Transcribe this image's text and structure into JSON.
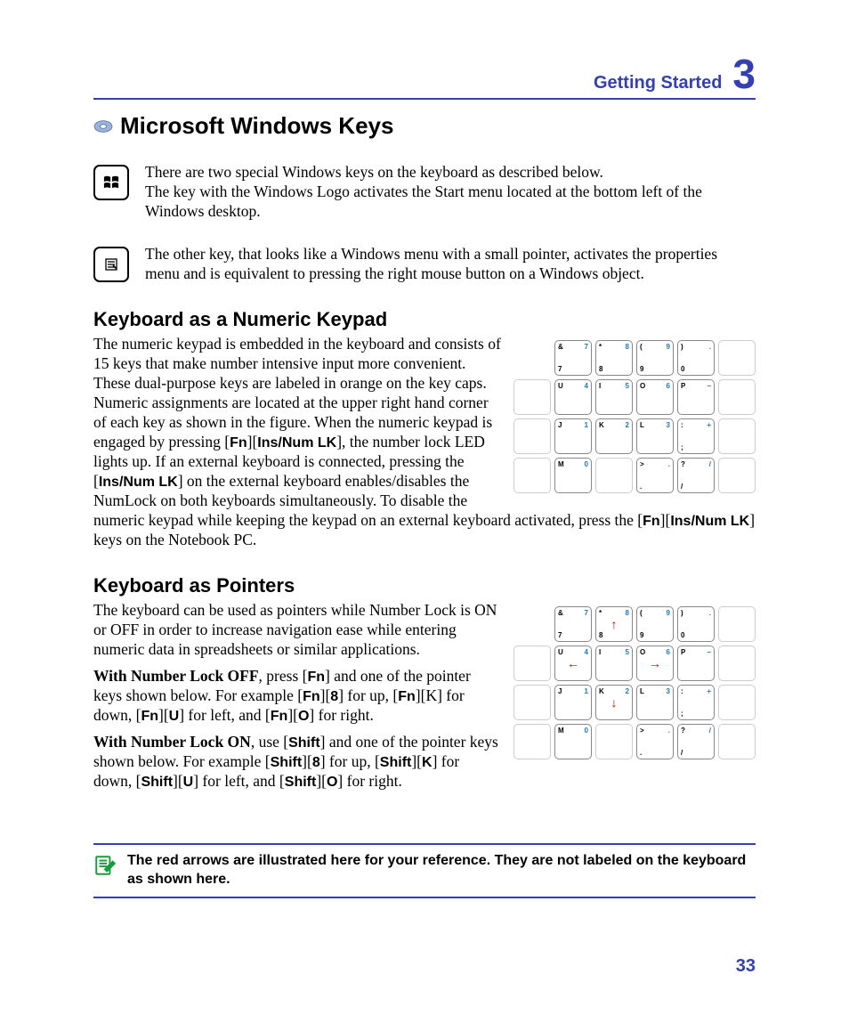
{
  "header": {
    "title": "Getting Started",
    "chapter": "3"
  },
  "sections": {
    "winkeys": {
      "title": "Microsoft Windows Keys",
      "block1": "There are two special Windows keys on the keyboard as described below.\nThe key with the Windows Logo activates the Start menu located at the bottom left of the Windows desktop.",
      "block2": "The other key, that looks like a Windows menu with a small pointer, activates the properties menu and is equivalent to pressing the right mouse button on a Windows object."
    },
    "numpad": {
      "title": "Keyboard as a Numeric Keypad",
      "pre": "The numeric keypad is embedded in the keyboard and consists of 15 keys that make number intensive input more convenient. These dual-purpose keys are labeled in orange on the key caps. Numeric assignments are located at the upper right hand corner of each key as shown in the figure. When the numeric keypad is engaged by pressing [",
      "k1": "Fn",
      "mid1": "][",
      "k2": "Ins/Num LK",
      "mid2": "], the number lock LED lights up. If an external keyboard is connected, pressing the [",
      "k3": "Ins/Num LK",
      "mid3": "] on the external keyboard enables/disables the NumLock on both keyboards simultaneously. To disable the numeric keypad while keeping the keypad on an external keyboard activated, press the  [",
      "k4": "Fn",
      "mid4": "][",
      "k5": "Ins/Num LK",
      "post": "] keys on the Notebook PC."
    },
    "pointers": {
      "title": "Keyboard as Pointers",
      "p1": "The keyboard can be used as pointers while Number Lock is ON or OFF in order to increase navigation ease while entering numeric data in spreadsheets or similar applications.",
      "off_label": "With Number Lock OFF",
      "off_a": ", press [",
      "off_fn1": "Fn",
      "off_b": "] and one of the pointer keys shown below. For example [",
      "off_fn2": "Fn",
      "off_c": "][",
      "off_8": "8",
      "off_d": "] for up, [",
      "off_fn3": "Fn",
      "off_e": "][K] for down, [",
      "off_fn4": "Fn",
      "off_f": "][",
      "off_u": "U",
      "off_g": "] for left, and [",
      "off_fn5": "Fn",
      "off_h": "][",
      "off_o": "O",
      "off_i": "] for right.",
      "on_label": "With Number Lock ON",
      "on_a": ", use [",
      "on_s1": "Shift",
      "on_b": "] and one of the pointer keys shown below. For example [",
      "on_s2": "Shift",
      "on_c": "][",
      "on_8": "8",
      "on_d": "] for up, [",
      "on_s3": "Shift",
      "on_e": "][",
      "on_k": "K",
      "on_f": "] for down, [",
      "on_s4": "Shift",
      "on_g": "][",
      "on_u": "U",
      "on_h": "] for left, and [",
      "on_s5": "Shift",
      "on_i": "][",
      "on_o": "O",
      "on_j": "] for right."
    }
  },
  "note": "The red arrows are illustrated here for your reference. They are not labeled on the keyboard as shown here.",
  "page_number": "33",
  "keypad": {
    "row1": [
      {
        "tl": "&",
        "bl": "7",
        "tr": "7"
      },
      {
        "tl": "*",
        "bl": "8",
        "tr": "8"
      },
      {
        "tl": "(",
        "bl": "9",
        "tr": "9"
      },
      {
        "tl": ")",
        "bl": "0",
        "tr": "."
      },
      {
        "blank": true
      }
    ],
    "row2": [
      {
        "blank": true
      },
      {
        "tl": "U",
        "tr": "4"
      },
      {
        "tl": "I",
        "tr": "5"
      },
      {
        "tl": "O",
        "tr": "6"
      },
      {
        "tl": "P",
        "tr": "−"
      },
      {
        "blank": true
      }
    ],
    "row3": [
      {
        "blank": true
      },
      {
        "tl": "J",
        "tr": "1"
      },
      {
        "tl": "K",
        "tr": "2"
      },
      {
        "tl": "L",
        "tr": "3"
      },
      {
        "tl": ":",
        "bl": ";",
        "tr": "+"
      },
      {
        "blank": true
      }
    ],
    "row4": [
      {
        "blank": true
      },
      {
        "tl": "M",
        "tr": "0"
      },
      {
        "blank": true
      },
      {
        "tl": ">",
        "bl": ".",
        "tr": "."
      },
      {
        "tl": "?",
        "bl": "/",
        "tr": "/"
      },
      {
        "blank": true
      }
    ]
  },
  "keypad_arrows": {
    "row1": [
      {
        "tl": "&",
        "bl": "7",
        "tr": "7"
      },
      {
        "tl": "*",
        "bl": "8",
        "tr": "8",
        "arrow": "↑"
      },
      {
        "tl": "(",
        "bl": "9",
        "tr": "9"
      },
      {
        "tl": ")",
        "bl": "0",
        "tr": "."
      },
      {
        "blank": true
      }
    ],
    "row2": [
      {
        "blank": true
      },
      {
        "tl": "U",
        "tr": "4",
        "arrow": "←"
      },
      {
        "tl": "I",
        "tr": "5"
      },
      {
        "tl": "O",
        "tr": "6",
        "arrow": "→"
      },
      {
        "tl": "P",
        "tr": "−"
      },
      {
        "blank": true
      }
    ],
    "row3": [
      {
        "blank": true
      },
      {
        "tl": "J",
        "tr": "1"
      },
      {
        "tl": "K",
        "tr": "2",
        "arrow": "↓"
      },
      {
        "tl": "L",
        "tr": "3"
      },
      {
        "tl": ":",
        "bl": ";",
        "tr": "+"
      },
      {
        "blank": true
      }
    ],
    "row4": [
      {
        "blank": true
      },
      {
        "tl": "M",
        "tr": "0"
      },
      {
        "blank": true
      },
      {
        "tl": ">",
        "bl": ".",
        "tr": "."
      },
      {
        "tl": "?",
        "bl": "/",
        "tr": "/"
      },
      {
        "blank": true
      }
    ]
  }
}
